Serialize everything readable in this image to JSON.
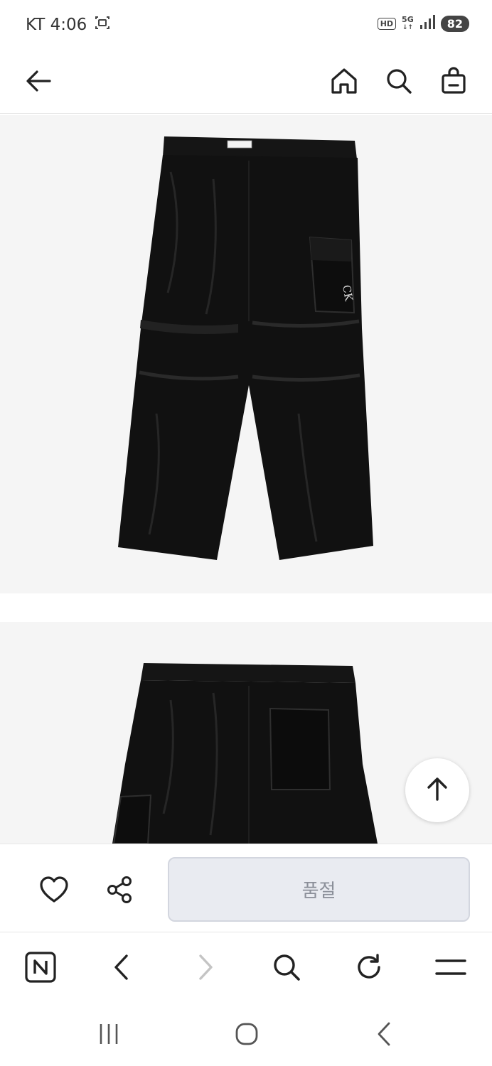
{
  "status_bar": {
    "carrier_time": "KT 4:06",
    "hd_label": "HD",
    "network_label": "5G",
    "battery_level": "82",
    "icons": [
      "screenshot-icon",
      "signal-icon"
    ]
  },
  "header": {
    "icons": [
      "back-arrow-icon",
      "home-icon",
      "search-icon",
      "shopping-bag-icon"
    ]
  },
  "product_images": [
    {
      "view": "front",
      "logo_text": "CK"
    },
    {
      "view": "back"
    }
  ],
  "scroll_top": {
    "icon": "arrow-up-icon"
  },
  "purchase_bar": {
    "wishlist_icon": "heart-icon",
    "share_icon": "share-icon",
    "soldout_label": "품절"
  },
  "browser_toolbar": {
    "icons": [
      "naver-n-icon",
      "back-chevron-icon",
      "forward-chevron-icon",
      "search-icon",
      "refresh-icon",
      "menu-icon"
    ]
  },
  "system_nav": {
    "icons": [
      "recent-apps-icon",
      "home-circle-icon",
      "back-icon"
    ]
  },
  "colors": {
    "accent": "#222222",
    "image_bg": "#f5f5f5",
    "soldout_bg": "#e9ebf1",
    "soldout_text": "#8b8f99",
    "disabled": "#c4c4c4"
  }
}
